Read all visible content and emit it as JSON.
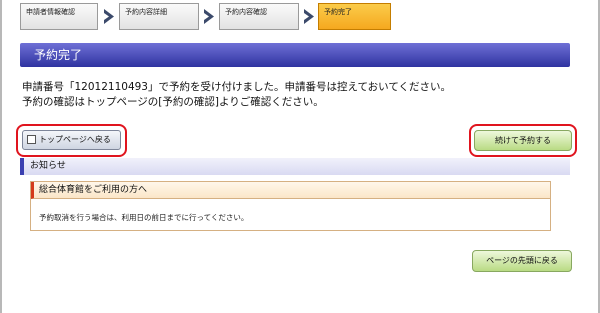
{
  "steps": [
    {
      "label": "申請者情報確認"
    },
    {
      "label": "予約内容詳細"
    },
    {
      "label": "予約内容確認"
    },
    {
      "label": "予約完了"
    }
  ],
  "page_title": "予約完了",
  "message": {
    "line1": "申請番号「12012110493」で予約を受け付けました。申請番号は控えておいてください。",
    "line2": "予約の確認はトップページの[予約の確認]よりご確認ください。"
  },
  "buttons": {
    "top_page": "トップページへ戻る",
    "continue_reserve": "続けて予約する",
    "page_top": "ページの先頭に戻る"
  },
  "notice": {
    "section_title": "お知らせ",
    "box_title": "総合体育館をご利用の方へ",
    "body": "予約取消を行う場合は、利用日の前日までに行ってください。"
  },
  "colors": {
    "title_bar": "#2f33a0",
    "active_step": "#f5a81f",
    "highlight": "#e0141e",
    "green_button": "#b9db84"
  }
}
